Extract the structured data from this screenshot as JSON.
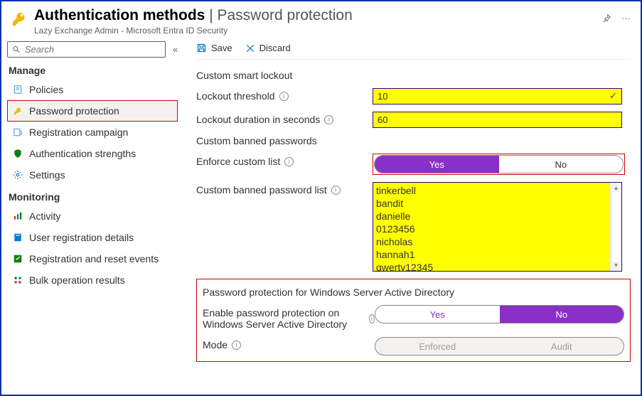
{
  "header": {
    "title_left": "Authentication methods",
    "title_right": "Password protection",
    "subtitle": "Lazy Exchange Admin - Microsoft Entra ID Security"
  },
  "search": {
    "placeholder": "Search"
  },
  "sidebar": {
    "manage_label": "Manage",
    "monitoring_label": "Monitoring",
    "items": {
      "policies": "Policies",
      "password_protection": "Password protection",
      "registration_campaign": "Registration campaign",
      "auth_strengths": "Authentication strengths",
      "settings": "Settings",
      "activity": "Activity",
      "user_reg_details": "User registration details",
      "reg_reset_events": "Registration and reset events",
      "bulk_op_results": "Bulk operation results"
    }
  },
  "cmdbar": {
    "save": "Save",
    "discard": "Discard"
  },
  "sections": {
    "lockout_title": "Custom smart lockout",
    "lockout_threshold_label": "Lockout threshold",
    "lockout_threshold_value": "10",
    "lockout_duration_label": "Lockout duration in seconds",
    "lockout_duration_value": "60",
    "banned_title": "Custom banned passwords",
    "enforce_label": "Enforce custom list",
    "toggle_yes": "Yes",
    "toggle_no": "No",
    "banned_list_label": "Custom banned password list",
    "banned_list_value": "tinkerbell\nbandit\ndanielle\n0123456\nnicholas\nhannah1\nqwerty12345",
    "winad_title": "Password protection for Windows Server Active Directory",
    "winad_enable_label": "Enable password protection on Windows Server Active Directory",
    "mode_label": "Mode",
    "mode_enforced": "Enforced",
    "mode_audit": "Audit"
  }
}
